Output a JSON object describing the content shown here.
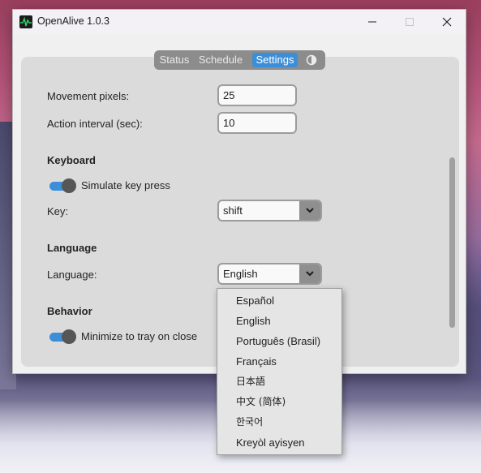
{
  "window": {
    "title": "OpenAlive 1.0.3",
    "controls": {
      "minimize": "—",
      "maximize": "☐",
      "close": "✕"
    }
  },
  "tabs": [
    {
      "label": "Status"
    },
    {
      "label": "Schedule"
    },
    {
      "label": "Settings",
      "active": true
    },
    {
      "icon": "sun-moon-icon"
    }
  ],
  "settings": {
    "movement_label": "Movement pixels:",
    "movement_value": "25",
    "interval_label": "Action interval (sec):",
    "interval_value": "10",
    "keyboard": {
      "heading": "Keyboard",
      "simulate_label": "Simulate key press",
      "simulate_on": true,
      "key_label": "Key:",
      "key_value": "shift"
    },
    "language": {
      "heading": "Language",
      "label": "Language:",
      "value": "English"
    },
    "behavior": {
      "heading": "Behavior",
      "minimize_label": "Minimize to tray on close",
      "minimize_on": true
    }
  },
  "language_dropdown": {
    "options": [
      "Español",
      "English",
      "Português (Brasil)",
      "Français",
      "日本語",
      "中文 (简体)",
      "한국어",
      "Kreyòl ayisyen"
    ]
  },
  "colors": {
    "accent": "#3d8ed8",
    "panel": "#dbdbdb",
    "tabbar": "#8c8c8c"
  }
}
